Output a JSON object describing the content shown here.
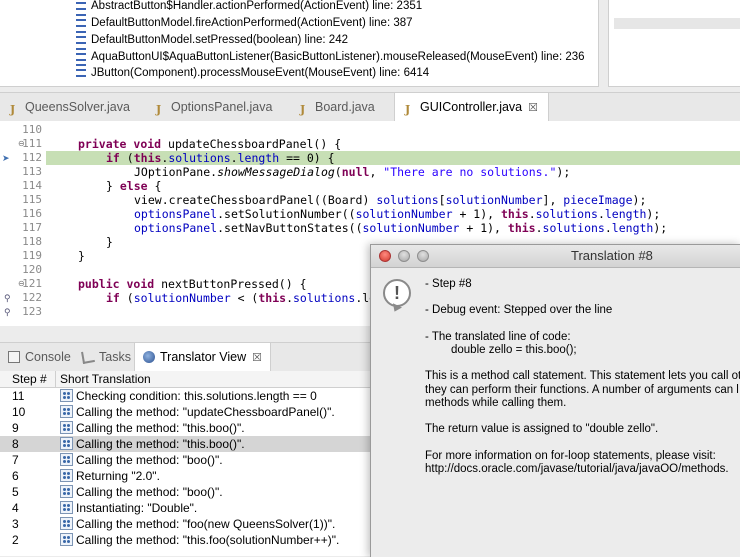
{
  "stack_frames": [
    "AbstractButton$Handler.actionPerformed(ActionEvent) line: 2351",
    "DefaultButtonModel.fireActionPerformed(ActionEvent) line: 387",
    "DefaultButtonModel.setPressed(boolean) line: 242",
    "AquaButtonUI$AquaButtonListener(BasicButtonListener).mouseReleased(MouseEvent) line: 236",
    "JButton(Component).processMouseEvent(MouseEvent) line: 6414"
  ],
  "editor_tabs": [
    {
      "label": "QueensSolver.java"
    },
    {
      "label": "OptionsPanel.java"
    },
    {
      "label": "Board.java"
    },
    {
      "label": "GUIController.java",
      "close": "☒"
    }
  ],
  "line_numbers": [
    "110",
    "111",
    "112",
    "113",
    "114",
    "115",
    "116",
    "117",
    "118",
    "119",
    "120",
    "121",
    "122",
    "123"
  ],
  "code": {
    "l111": {
      "kw1": "private",
      "kw2": "void",
      "rest": " updateChessboardPanel() {"
    },
    "l112": {
      "kw1": "if",
      "p1": " (",
      "kw2": "this",
      "p2": ".",
      "f1": "solutions",
      "p3": ".",
      "f2": "length",
      "p4": " == 0) {"
    },
    "l113": {
      "p1": "JOptionPane.",
      "m": "showMessageDialog",
      "p2": "(",
      "kw": "null",
      "p3": ", ",
      "s": "\"There are no solutions.\"",
      "p4": ");"
    },
    "l114": {
      "p1": "} ",
      "kw": "else",
      "p2": " {"
    },
    "l115": {
      "p1": "view.createChessboardPanel((Board) ",
      "f1": "solutions",
      "p2": "[",
      "f2": "solutionNumber",
      "p3": "], ",
      "f3": "pieceImage",
      "p4": ");"
    },
    "l116": {
      "p1": "optionsPanel",
      "p2": ".setSolutionNumber((",
      "f1": "solutionNumber",
      "p3": " + 1), ",
      "kw": "this",
      "p4": ".",
      "f2": "solutions",
      "p5": ".",
      "f3": "length",
      "p6": ");"
    },
    "l117": {
      "p1": "optionsPanel",
      "p2": ".setNavButtonStates((",
      "f1": "solutionNumber",
      "p3": " + 1), ",
      "kw": "this",
      "p4": ".",
      "f2": "solutions",
      "p5": ".",
      "f3": "length",
      "p6": ");"
    },
    "l118": "}",
    "l119": "}",
    "l121": {
      "kw1": "public",
      "kw2": "void",
      "rest": " nextButtonPressed() {"
    },
    "l122": {
      "kw1": "if",
      "p1": " (",
      "f1": "solutionNumber",
      "p2": " < (",
      "kw2": "this",
      "p3": ".",
      "f2": "solutions",
      "p4": ".len"
    }
  },
  "view_tabs": [
    {
      "label": "Console"
    },
    {
      "label": "Tasks"
    },
    {
      "label": "Translator View",
      "close": "☒"
    }
  ],
  "table": {
    "headers": [
      "Step #",
      "Short Translation"
    ],
    "rows": [
      {
        "step": "11",
        "text": "Checking condition: this.solutions.length == 0"
      },
      {
        "step": "10",
        "text": "Calling the method: \"updateChessboardPanel()\"."
      },
      {
        "step": "9",
        "text": "Calling the method: \"this.boo()\"."
      },
      {
        "step": "8",
        "text": "Calling the method: \"this.boo()\"."
      },
      {
        "step": "7",
        "text": "Calling the method: \"boo()\"."
      },
      {
        "step": "6",
        "text": "Returning \"2.0\"."
      },
      {
        "step": "5",
        "text": "Calling the method: \"boo()\"."
      },
      {
        "step": "4",
        "text": "Instantiating: \"Double\"."
      },
      {
        "step": "3",
        "text": "Calling the method: \"foo(new QueensSolver(1))\"."
      },
      {
        "step": "2",
        "text": "Calling the method: \"this.foo(solutionNumber++)\"."
      }
    ],
    "selected_step": "8"
  },
  "dialog": {
    "title": "Translation #8",
    "icon": "!",
    "lines": [
      "- Step #8",
      "- Debug event: Stepped over the line",
      "- The translated line of code:",
      "double zello = this.boo();",
      "This is a method call statement. This statement lets you call ot",
      "they can perform their functions. A number of arguments can l",
      "methods while calling them.",
      "The return value is assigned to \"double zello\".",
      "For more information on for-loop statements, please visit:",
      "http://docs.oracle.com/javase/tutorial/java/javaOO/methods."
    ]
  },
  "colors": {
    "highlight_line": "#c7dfb5",
    "keyword": "#7f0055",
    "field": "#0000c0",
    "string": "#2a00ff",
    "selected_row": "#d5d5d5"
  }
}
